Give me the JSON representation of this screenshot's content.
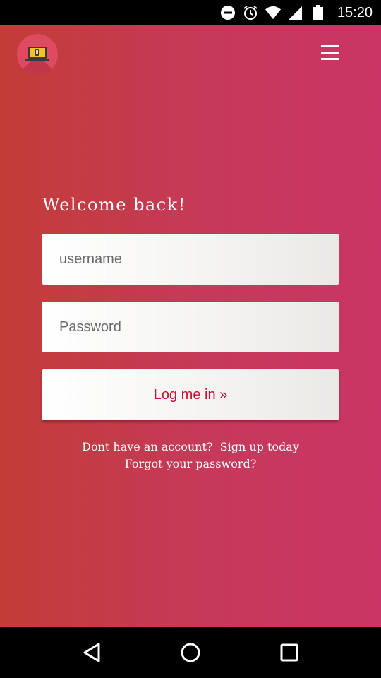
{
  "status_bar": {
    "time": "15:20",
    "icons": [
      "do-not-disturb-icon",
      "alarm-icon",
      "wifi-icon",
      "signal-icon",
      "battery-icon"
    ]
  },
  "header": {
    "logo_icon": "laptop-icon",
    "menu_icon": "hamburger-menu-icon"
  },
  "login": {
    "welcome": "Welcome back!",
    "username_placeholder": "username",
    "password_placeholder": "Password",
    "submit_label": "Log me in »",
    "no_account_text": "Dont have an account?",
    "signup_link": "Sign up today",
    "forgot_link": "Forgot your password?"
  },
  "nav_bar": {
    "icons": [
      "back-icon",
      "home-icon",
      "recents-icon"
    ]
  },
  "colors": {
    "gradient_start": "#c23d37",
    "gradient_end": "#cb3565",
    "button_text": "#c8102e"
  }
}
